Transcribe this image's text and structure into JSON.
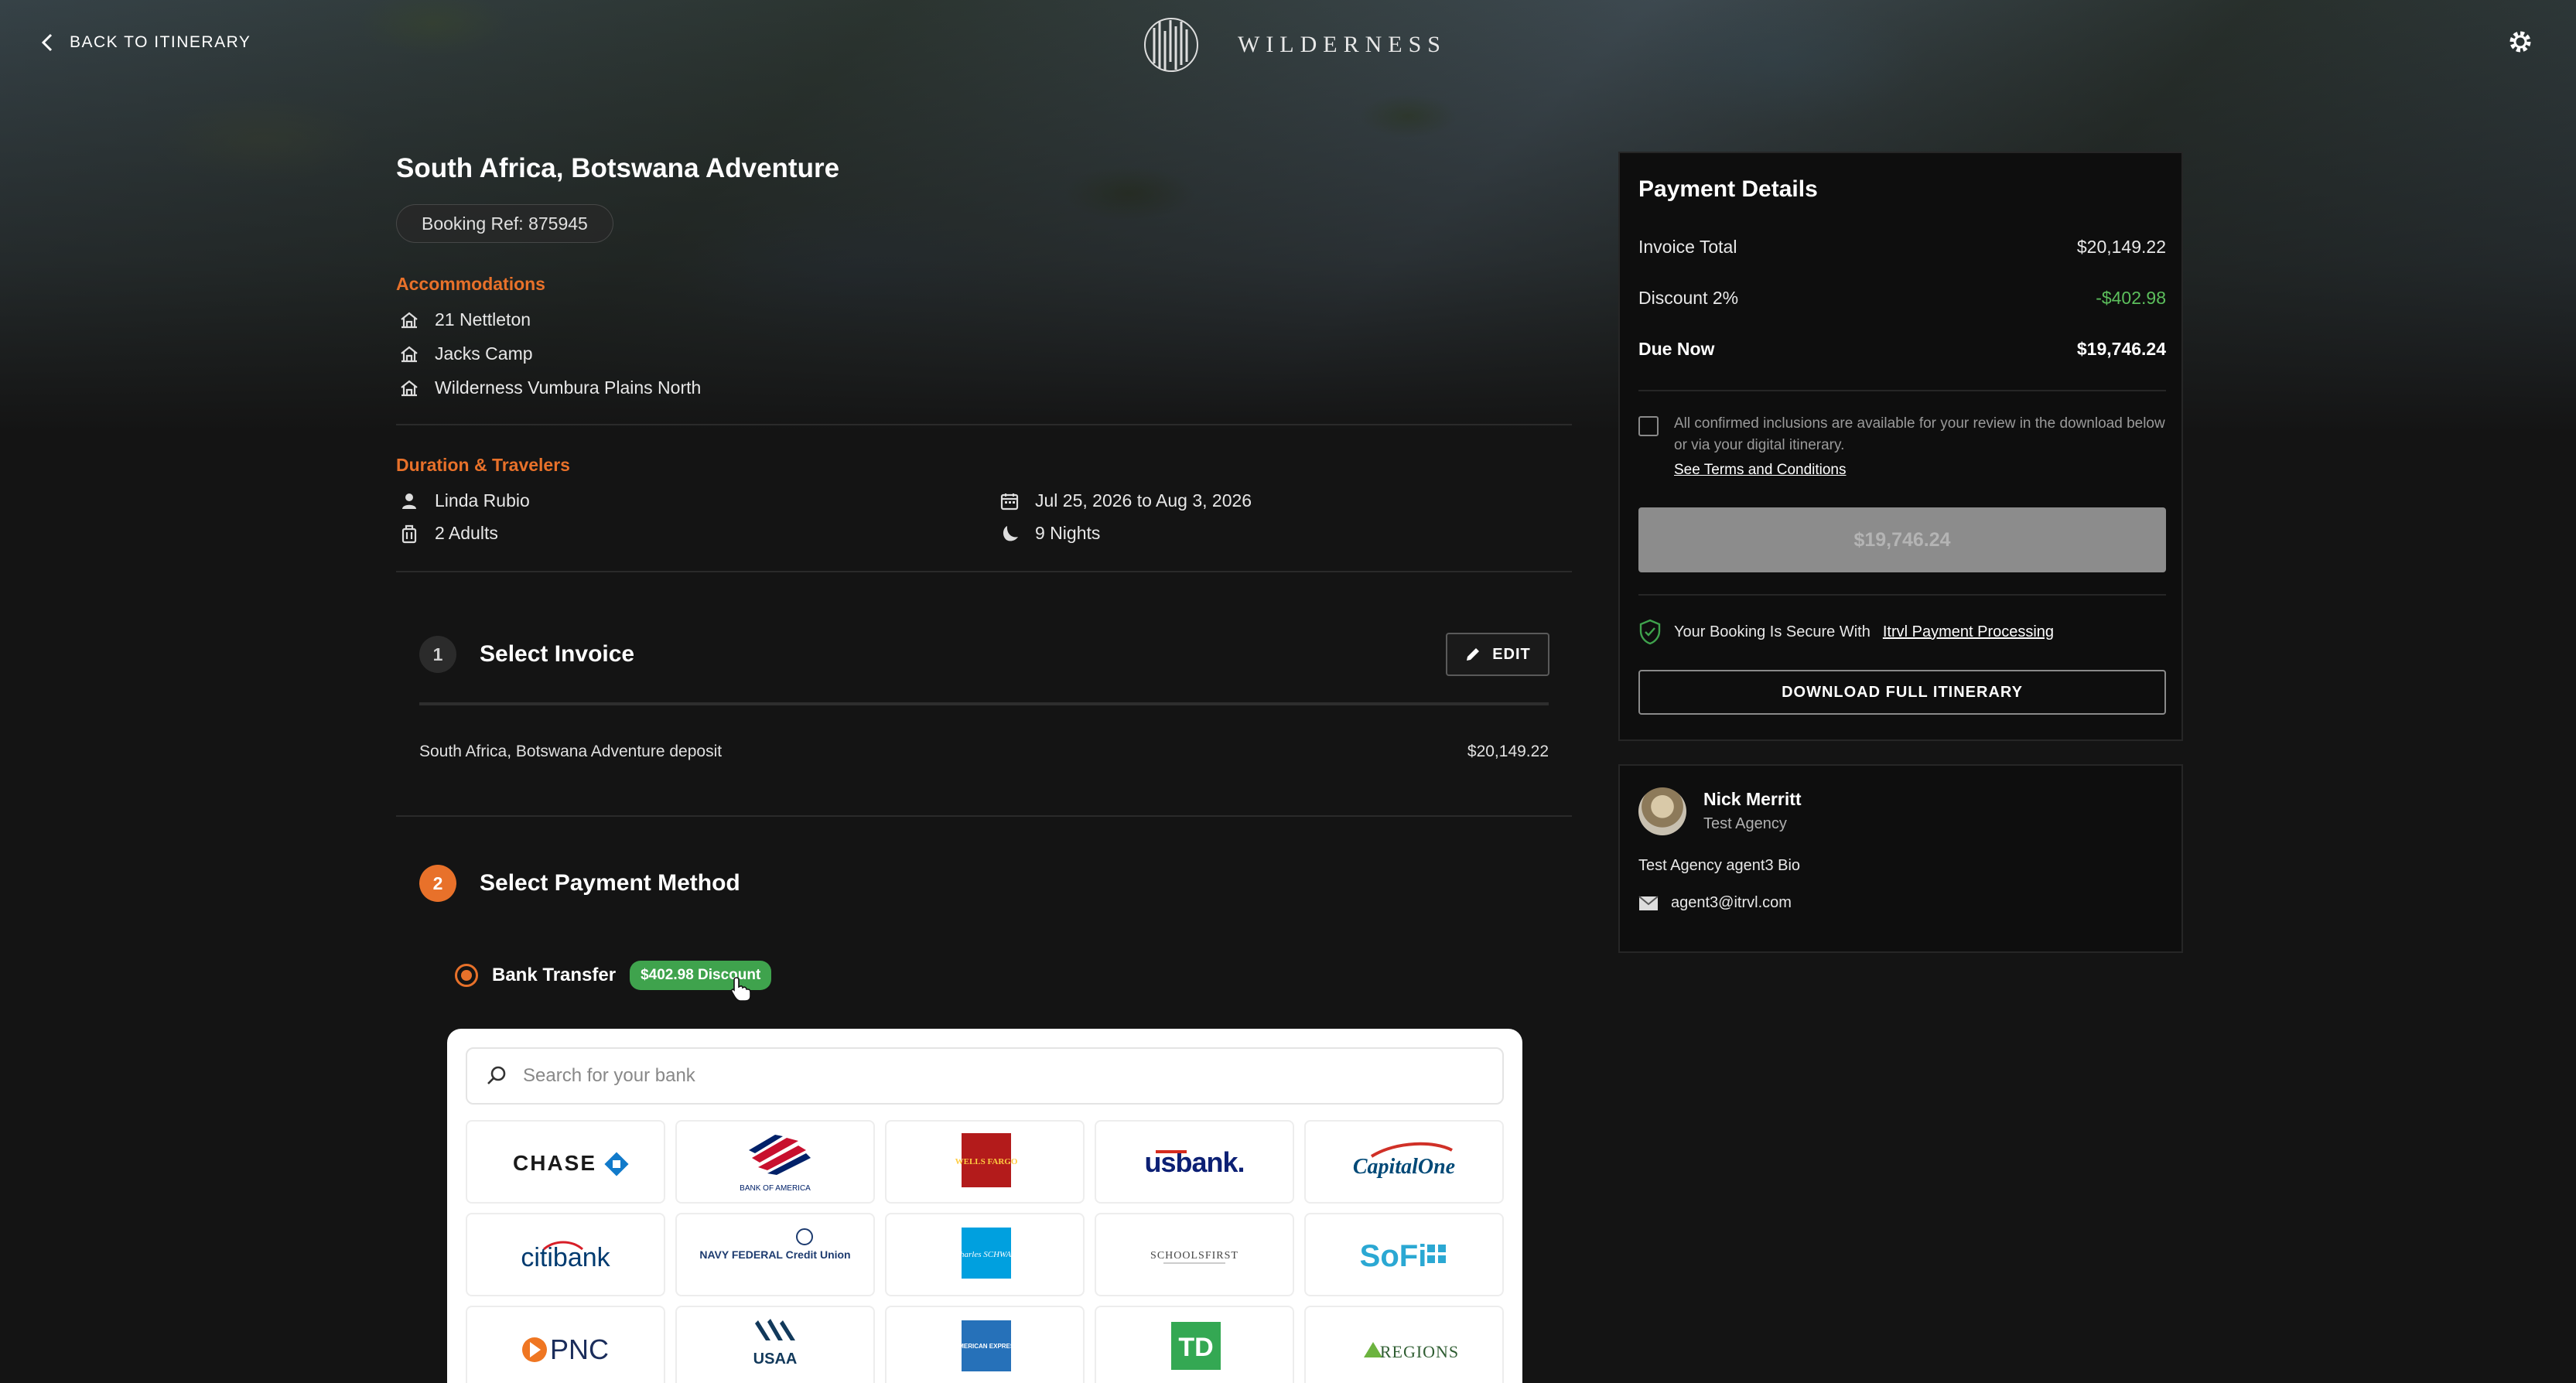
{
  "header": {
    "back_label": "BACK TO ITINERARY",
    "brand_name": "WILDERNESS"
  },
  "trip": {
    "title": "South Africa, Botswana Adventure",
    "booking_ref": "Booking Ref: 875945",
    "accommodations_label": "Accommodations",
    "accommodations": [
      "21 Nettleton",
      "Jacks Camp",
      "Wilderness Vumbura Plains North"
    ],
    "duration_label": "Duration & Travelers",
    "traveler_name": "Linda Rubio",
    "travelers": "2 Adults",
    "dates": "Jul 25, 2026 to Aug 3, 2026",
    "nights": "9 Nights"
  },
  "steps": {
    "invoice": {
      "number": "1",
      "title": "Select Invoice",
      "edit_label": "EDIT",
      "invoice_name": "South Africa, Botswana Adventure deposit",
      "invoice_amount": "$20,149.22"
    },
    "payment": {
      "number": "2",
      "title": "Select Payment Method",
      "method_label": "Bank Transfer",
      "discount_badge": "$402.98 Discount",
      "search_placeholder": "Search for your bank"
    }
  },
  "banks": [
    {
      "name": "Chase",
      "text": "CHASE"
    },
    {
      "name": "Bank of America",
      "text": "BANK OF AMERICA"
    },
    {
      "name": "Wells Fargo",
      "text": "WELLS FARGO"
    },
    {
      "name": "US Bank",
      "text": "usbank."
    },
    {
      "name": "Capital One",
      "text": "CapitalOne"
    },
    {
      "name": "Citibank",
      "text": "citibank"
    },
    {
      "name": "Navy Federal",
      "text": "NAVY FEDERAL Credit Union"
    },
    {
      "name": "Charles Schwab",
      "text": "charles SCHWAB"
    },
    {
      "name": "SchoolsFirst",
      "text": "SCHOOLSFIRST"
    },
    {
      "name": "SoFi",
      "text": "SoFi"
    },
    {
      "name": "PNC",
      "text": "PNC"
    },
    {
      "name": "USAA",
      "text": "USAA"
    },
    {
      "name": "American Express",
      "text": "AMERICAN EXPRESS"
    },
    {
      "name": "TD",
      "text": "TD"
    },
    {
      "name": "Regions",
      "text": "REGIONS"
    }
  ],
  "payment": {
    "title": "Payment Details",
    "invoice_total_label": "Invoice Total",
    "invoice_total": "$20,149.22",
    "discount_label": "Discount 2%",
    "discount_value": "-$402.98",
    "due_now_label": "Due Now",
    "due_now": "$19,746.24",
    "consent_text": "All confirmed inclusions are available for your review in the download below or via your digital itinerary.",
    "terms_link": "See Terms and Conditions",
    "pay_button": "$19,746.24",
    "secure_text": "Your Booking Is Secure With",
    "secure_link": "Itrvl Payment Processing",
    "download_button": "DOWNLOAD FULL ITINERARY"
  },
  "agent": {
    "name": "Nick Merritt",
    "agency": "Test Agency",
    "bio": "Test Agency agent3 Bio",
    "email": "agent3@itrvl.com"
  },
  "colors": {
    "accent": "#e8712a",
    "discount_green": "#3fa34d",
    "background": "#141414"
  }
}
